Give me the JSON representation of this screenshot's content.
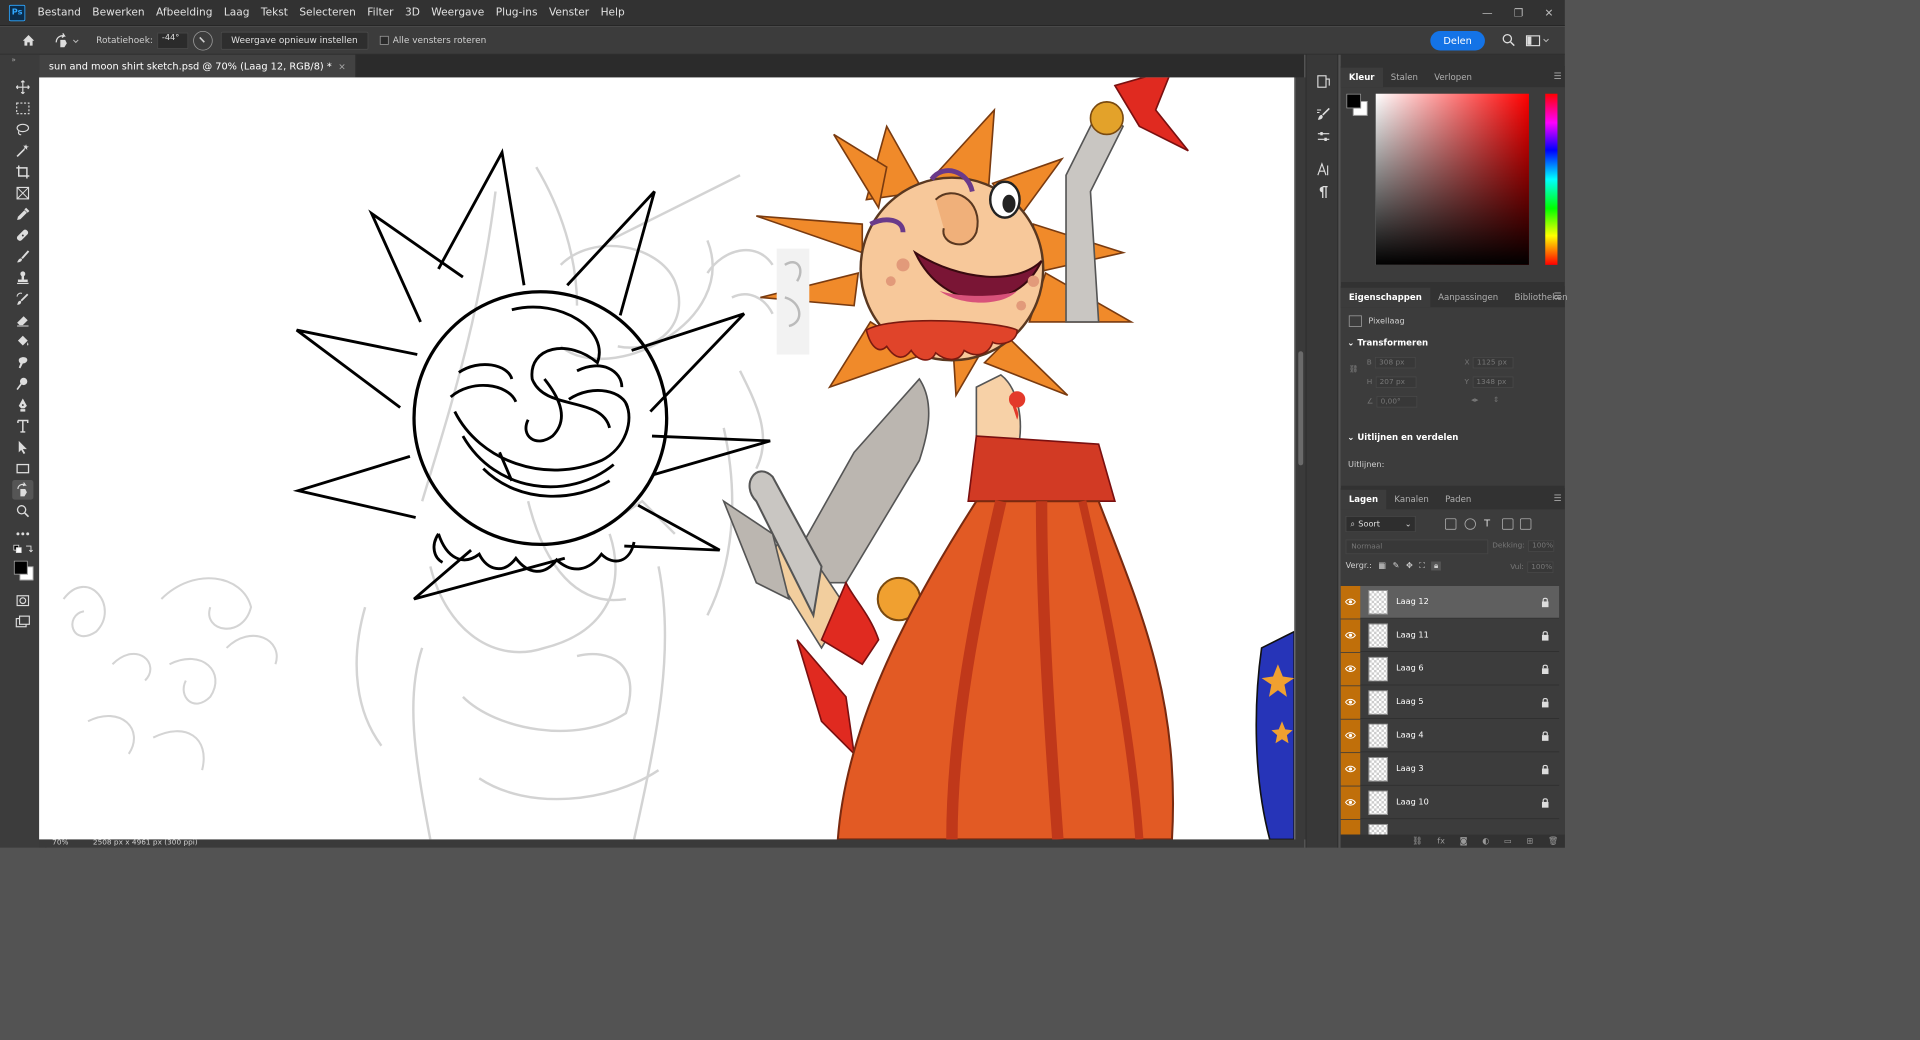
{
  "app": {
    "logo": "Ps"
  },
  "menu": [
    "Bestand",
    "Bewerken",
    "Afbeelding",
    "Laag",
    "Tekst",
    "Selecteren",
    "Filter",
    "3D",
    "Weergave",
    "Plug-ins",
    "Venster",
    "Help"
  ],
  "window_controls": {
    "minimize": "—",
    "maximize": "❐",
    "close": "✕"
  },
  "options": {
    "rotation_label": "Rotatiehoek:",
    "rotation_value": "-44°",
    "reset_label": "Weergave opnieuw instellen",
    "rotate_all_label": "Alle vensters roteren",
    "share_label": "Delen"
  },
  "document": {
    "tab_title": "sun and moon shirt sketch.psd @ 70% (Laag 12, RGB/8) *",
    "close": "×"
  },
  "status": {
    "zoom": "70%",
    "size": "2508 px x 4961 px (300 ppi)"
  },
  "color_panel": {
    "tabs": [
      "Kleur",
      "Stalen",
      "Verlopen"
    ],
    "fg": "#000000",
    "bg": "#ffffff"
  },
  "properties_panel": {
    "tabs": [
      "Eigenschappen",
      "Aanpassingen",
      "Bibliotheken"
    ],
    "layer_type": "Pixellaag",
    "transform_title": "Transformeren",
    "w_label": "B",
    "w_value": "308 px",
    "x_label": "X",
    "x_value": "1125 px",
    "h_label": "H",
    "h_value": "207 px",
    "y_label": "Y",
    "y_value": "1348 px",
    "angle_value": "0,00°",
    "align_title": "Uitlijnen en verdelen",
    "align_label": "Uitlijnen:"
  },
  "layers_panel": {
    "tabs": [
      "Lagen",
      "Kanalen",
      "Paden"
    ],
    "filter_label": "Soort",
    "blend_mode": "Normaal",
    "opacity_label": "Dekking:",
    "opacity_value": "100%",
    "lock_label": "Vergr.:",
    "fill_label": "Vul:",
    "fill_value": "100%",
    "layers": [
      {
        "name": "Laag 12",
        "selected": true
      },
      {
        "name": "Laag 11",
        "selected": false
      },
      {
        "name": "Laag 6",
        "selected": false
      },
      {
        "name": "Laag 5",
        "selected": false
      },
      {
        "name": "Laag 4",
        "selected": false
      },
      {
        "name": "Laag 3",
        "selected": false
      },
      {
        "name": "Laag 10",
        "selected": false
      },
      {
        "name": "",
        "selected": false
      }
    ],
    "bottom_icons": [
      "link-icon",
      "fx-icon",
      "mask-icon",
      "adjustment-icon",
      "group-icon",
      "new-layer-icon",
      "trash-icon"
    ]
  },
  "colors": {
    "accent": "#1473e6",
    "eye_column": "#c06f0a",
    "ps_blue": "#31a8ff"
  }
}
